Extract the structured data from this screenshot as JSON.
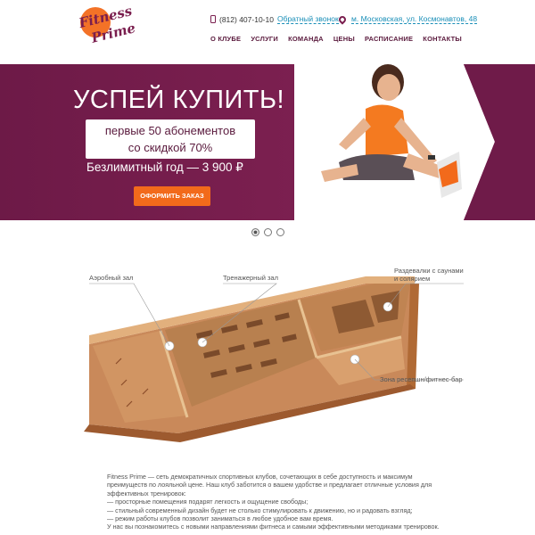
{
  "header": {
    "logo": {
      "line1": "Fitness",
      "line2": "Prime"
    },
    "phone": "(812) 407-10-10",
    "callback_label": "Обратный звонок",
    "address": "м. Московская, ул. Космонавтов, 48",
    "nav": [
      "О КЛУБЕ",
      "УСЛУГИ",
      "КОМАНДА",
      "ЦЕНЫ",
      "РАСПИСАНИЕ",
      "КОНТАКТЫ"
    ]
  },
  "banner": {
    "headline": "УСПЕЙ КУПИТЬ!",
    "promo_line1": "первые 50 абонементов",
    "promo_line2": "со скидкой 70%",
    "price_line": "Безлимитный год — 3 900 ₽",
    "order_button": "ОФОРМИТЬ ЗАКАЗ",
    "colors": {
      "purple": "#7a1e4e",
      "orange": "#f26a1b"
    }
  },
  "slider": {
    "count": 3,
    "active_index": 0
  },
  "floorplan": {
    "labels": {
      "aerobic": "Аэробный зал",
      "gym": "Тренажерный зал",
      "lockers_line1": "Раздевалки с саунами",
      "lockers_line2": "и солярием",
      "reception": "Зона ресепшн/фитнес-бар"
    }
  },
  "description": {
    "lines": [
      "Fitness Prime — сеть демократичных спортивных клубов, сочетающих в себе доступность и максимум",
      "преимуществ по лояльной цене. Наш клуб заботится о вашем удобстве и предлагает отличные условия для",
      "эффективных тренировок:",
      "— просторные помещения подарят легкость и ощущение свободы;",
      "— стильный современный дизайн будет не столько стимулировать к движению, но и радовать взгляд;",
      "— режим работы клубов позволит заниматься в любое удобное вам время.",
      "У нас вы познакомитесь с новыми направлениями фитнеса и самыми эффективными методиками тренировок."
    ]
  }
}
